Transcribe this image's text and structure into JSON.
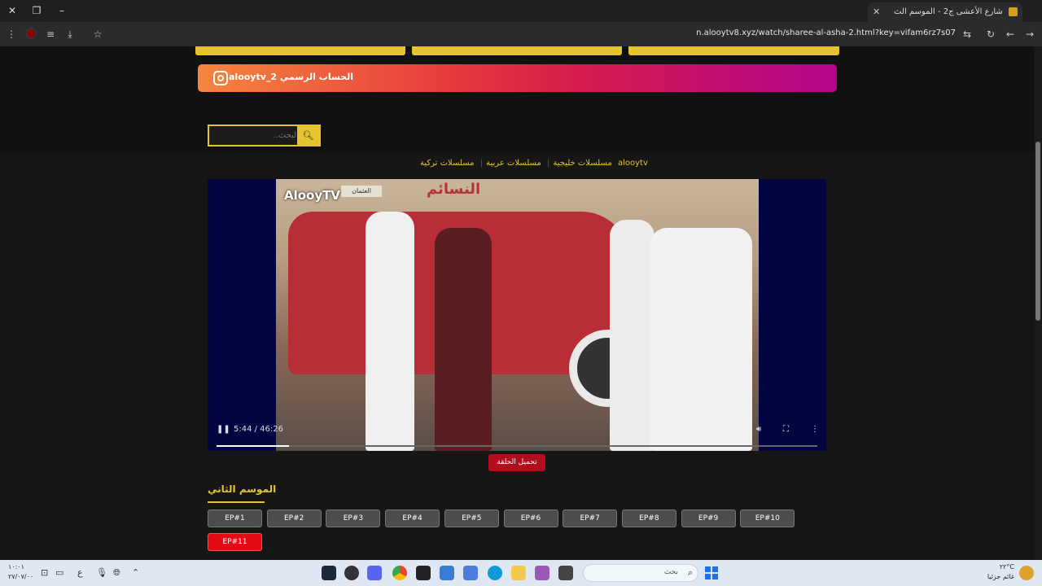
{
  "browser": {
    "tab_title": "شارع الأعشى ج2 - الموسم الث",
    "url": "n.alooytv8.xyz/watch/sharee-al-asha-2.html?key=vifam6rz7s07"
  },
  "instagram": {
    "label": "alooytv_2 الحساب الرسمي"
  },
  "search": {
    "placeholder": "البحث.."
  },
  "nav": {
    "items": [
      "alooytv",
      "مسلسلات خليجية",
      "مسلسلات عربية",
      "مسلسلات تركية"
    ]
  },
  "player": {
    "logo": "AlooyTV",
    "time": "5:44 / 46:26",
    "progress": 0.12,
    "wall_text": "النسائم",
    "sign_text": "العثمان"
  },
  "download_label": "تحميل الحلقة",
  "season": {
    "title": "الموسم الثاني"
  },
  "episodes": [
    "EP#1",
    "EP#2",
    "EP#3",
    "EP#4",
    "EP#5",
    "EP#6",
    "EP#7",
    "EP#8",
    "EP#9",
    "EP#10",
    "EP#11"
  ],
  "active_episode": "EP#11",
  "taskbar": {
    "search_text": "بحث",
    "weather_temp": "٢٢°C",
    "weather_desc": "غائم جزئيا",
    "time": "١٠:٠١",
    "date": "٢٧/٠٧/٠٠"
  }
}
